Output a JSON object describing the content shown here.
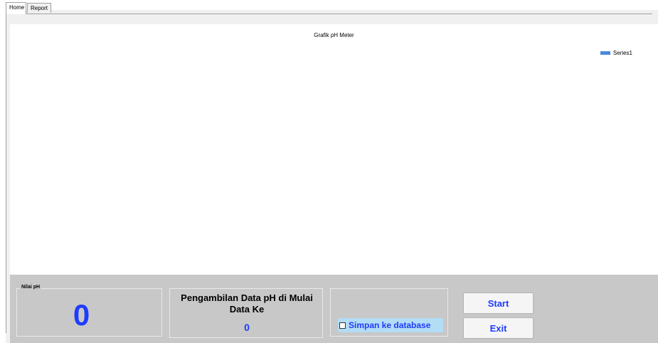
{
  "tabs": [
    {
      "label": "Home",
      "active": true
    },
    {
      "label": "Report",
      "active": false
    }
  ],
  "chart_data": {
    "type": "line",
    "title": "Grafik pH Meter",
    "series": [
      {
        "name": "Series1",
        "values": []
      }
    ],
    "legend_position": "top-right",
    "series_color": "#4a88de"
  },
  "ph_group": {
    "label": "Nilai pH",
    "value": "0"
  },
  "data_group": {
    "caption": "Pengambilan Data pH di Mulai Data Ke",
    "value": "0"
  },
  "save_option": {
    "label": "Simpan ke database",
    "checked": false
  },
  "buttons": {
    "start": "Start",
    "exit": "Exit"
  },
  "colors": {
    "value_blue": "#1e3cff",
    "panel_gray": "#c8c8c8",
    "highlight": "#b3dcf5"
  }
}
